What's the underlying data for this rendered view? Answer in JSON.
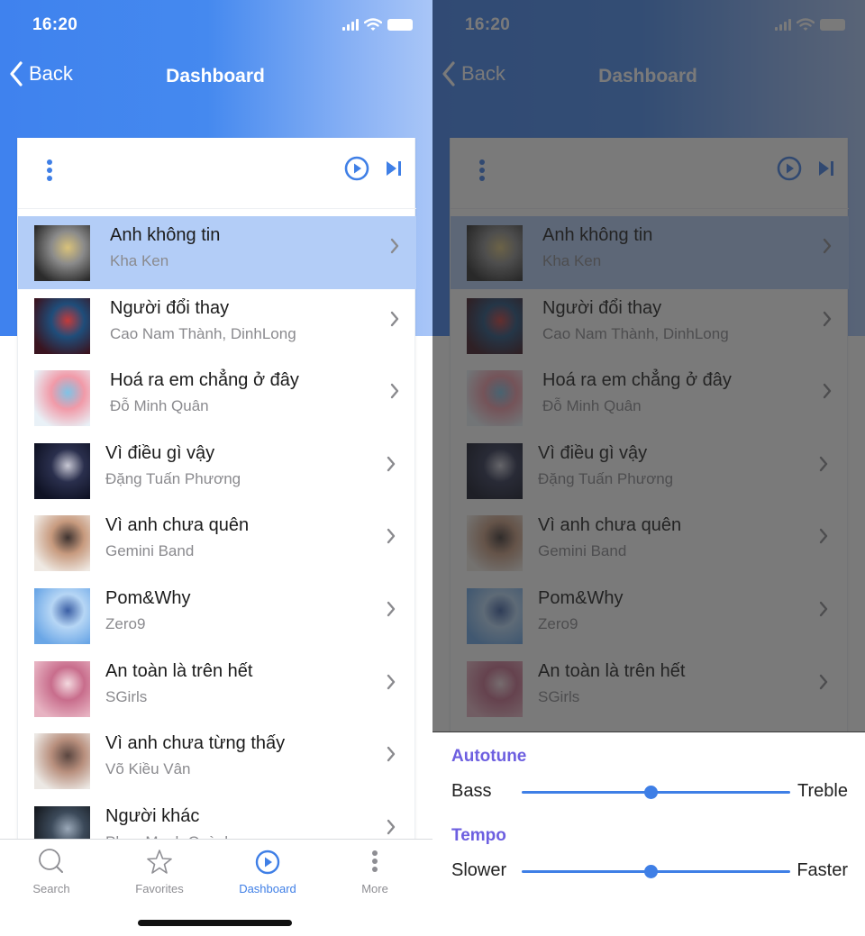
{
  "status_bar": {
    "time": "16:20"
  },
  "nav": {
    "back_label": "Back",
    "title": "Dashboard"
  },
  "colors": {
    "accent": "#3f7fe6",
    "selected_row": "#b3cdf7",
    "sheet_heading": "#6d5fe0",
    "header_start": "#3f82ee",
    "header_end": "#a9c6f7"
  },
  "player": {
    "menu_icon": "kebab-vertical-icon",
    "play_icon": "play-circle-icon",
    "skip_icon": "skip-next-icon"
  },
  "songs": [
    {
      "title": "Anh không tin",
      "artist": "Kha Ken",
      "selected": true,
      "art": [
        "#2b2b2b",
        "#8a8a8a",
        "#d9c27a"
      ]
    },
    {
      "title": "Người đổi thay",
      "artist": "Cao Nam Thành, DinhLong",
      "selected": false,
      "art": [
        "#3a1420",
        "#1f4d7a",
        "#c33a3a"
      ]
    },
    {
      "title": "Hoá ra em chẳng ở đây",
      "artist": "Đỗ Minh Quân",
      "selected": false,
      "art": [
        "#e9f1f7",
        "#f19aa8",
        "#7fc3e6"
      ]
    },
    {
      "title": "Vì điều gì vậy",
      "artist": "Đặng Tuấn Phương",
      "selected": false,
      "art": [
        "#0f1224",
        "#2a2f4d",
        "#c8c8d4"
      ]
    },
    {
      "title": "Vì anh chưa quên",
      "artist": "Gemini Band",
      "selected": false,
      "art": [
        "#efe9e3",
        "#c79a7e",
        "#3e3330"
      ]
    },
    {
      "title": "Pom&Why",
      "artist": "Zero9",
      "selected": false,
      "art": [
        "#6aa6e6",
        "#b6d6f5",
        "#3b5fa5"
      ]
    },
    {
      "title": "An toàn là trên hết",
      "artist": "SGirls",
      "selected": false,
      "art": [
        "#e7b3c2",
        "#c86d8c",
        "#f3d9df"
      ]
    },
    {
      "title": "Vì anh chưa từng thấy",
      "artist": "Võ Kiều Vân",
      "selected": false,
      "art": [
        "#ece8e4",
        "#b88f7d",
        "#5a4640"
      ]
    },
    {
      "title": "Người khác",
      "artist": "Phan Mạnh Quỳnh",
      "selected": false,
      "art": [
        "#15191f",
        "#3c4a5a",
        "#9aa8b8"
      ]
    }
  ],
  "tab_bar": {
    "tabs": [
      {
        "label": "Search",
        "icon": "search-icon",
        "active": false
      },
      {
        "label": "Favorites",
        "icon": "star-icon",
        "active": false
      },
      {
        "label": "Dashboard",
        "icon": "play-circle-icon",
        "active": true
      },
      {
        "label": "More",
        "icon": "kebab-vertical-icon",
        "active": false
      }
    ]
  },
  "sheet": {
    "sections": [
      {
        "heading": "Autotune",
        "min_label": "Bass",
        "max_label": "Treble",
        "value": 0.48
      },
      {
        "heading": "Tempo",
        "min_label": "Slower",
        "max_label": "Faster",
        "value": 0.48
      }
    ]
  }
}
